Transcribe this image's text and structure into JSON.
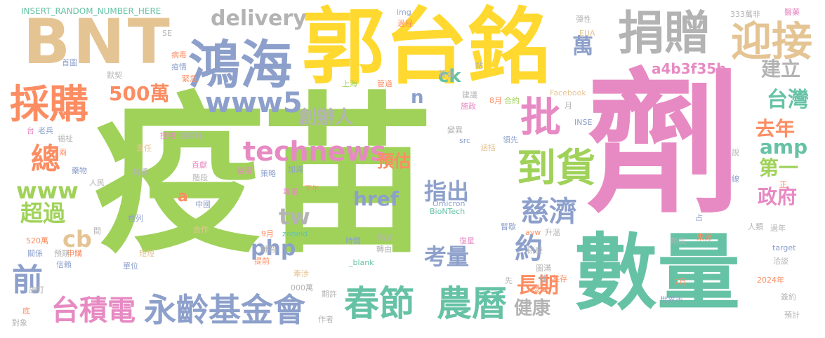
{
  "palette": {
    "green": "#a0d25a",
    "pink": "#e78ac3",
    "teal": "#66c2a5",
    "orange": "#fc8d62",
    "blue": "#8da0cb",
    "yellow": "#ffd92f",
    "tan": "#e5c494",
    "gray": "#b3b3b3"
  },
  "words": [
    "疫苗",
    "劑",
    "數量",
    "郭台銘",
    "BNT",
    "鴻海",
    "捐贈",
    "迎接",
    "採購",
    "批",
    "到貨",
    "春節",
    "農曆",
    "technews",
    "永齡基金會",
    "台積電",
    "www5",
    "delivery",
    "慈濟",
    "500萬",
    "www",
    "總",
    "tw",
    "php",
    "href",
    "指出",
    "考量",
    "約",
    "長期",
    "政府",
    "台灣",
    "去年",
    "第一",
    "萬",
    "建立",
    "amp",
    "超過",
    "健康",
    "前",
    "cb",
    "a4b3f35b",
    "創辦人",
    "預估",
    "n",
    "ck",
    "a",
    "INSERT_RANDOM_NUMBER_HERE",
    "img",
    "過程",
    "333萬非",
    "醫藥",
    "彈性",
    "EUA",
    "SE",
    "病毒",
    "疫情",
    "首圖",
    "默契",
    "緊急",
    "上海",
    "管道",
    "建議",
    "施政",
    "8月",
    "合約",
    "符合",
    "站",
    "Facebook",
    "月",
    "INSE",
    "台",
    "老兵",
    "福祉",
    "授權",
    "鍾榮峰",
    "責任",
    "變異",
    "涵括",
    "領先",
    "src",
    "說",
    "兩",
    "藥物",
    "持續",
    "貢獻",
    "階段",
    "值得",
    "策略",
    "加減",
    "人民",
    "線",
    "正",
    "中國",
    "專業",
    "下午",
    "Omicron",
    "BioNTech",
    "間",
    "框列",
    "合作",
    "zoneid",
    "9月",
    "暫歇",
    "avw",
    "升溫",
    "占",
    "人類",
    "過年",
    "來源",
    "關係",
    "520萬",
    "預期",
    "申購",
    "短短",
    "時間",
    "貼文",
    "復星",
    "研發",
    "劑次",
    "信賴",
    "單位",
    "雜音",
    "轉由",
    "圖滿",
    "target",
    "洽談",
    "提前",
    "_blank",
    "株",
    "共存",
    "穩定",
    "施打",
    "底",
    "000萬",
    "牽涉",
    "先",
    "2024年",
    "7月",
    "期許",
    "世界市",
    "簽約",
    "對象",
    "作者",
    "預計"
  ]
}
